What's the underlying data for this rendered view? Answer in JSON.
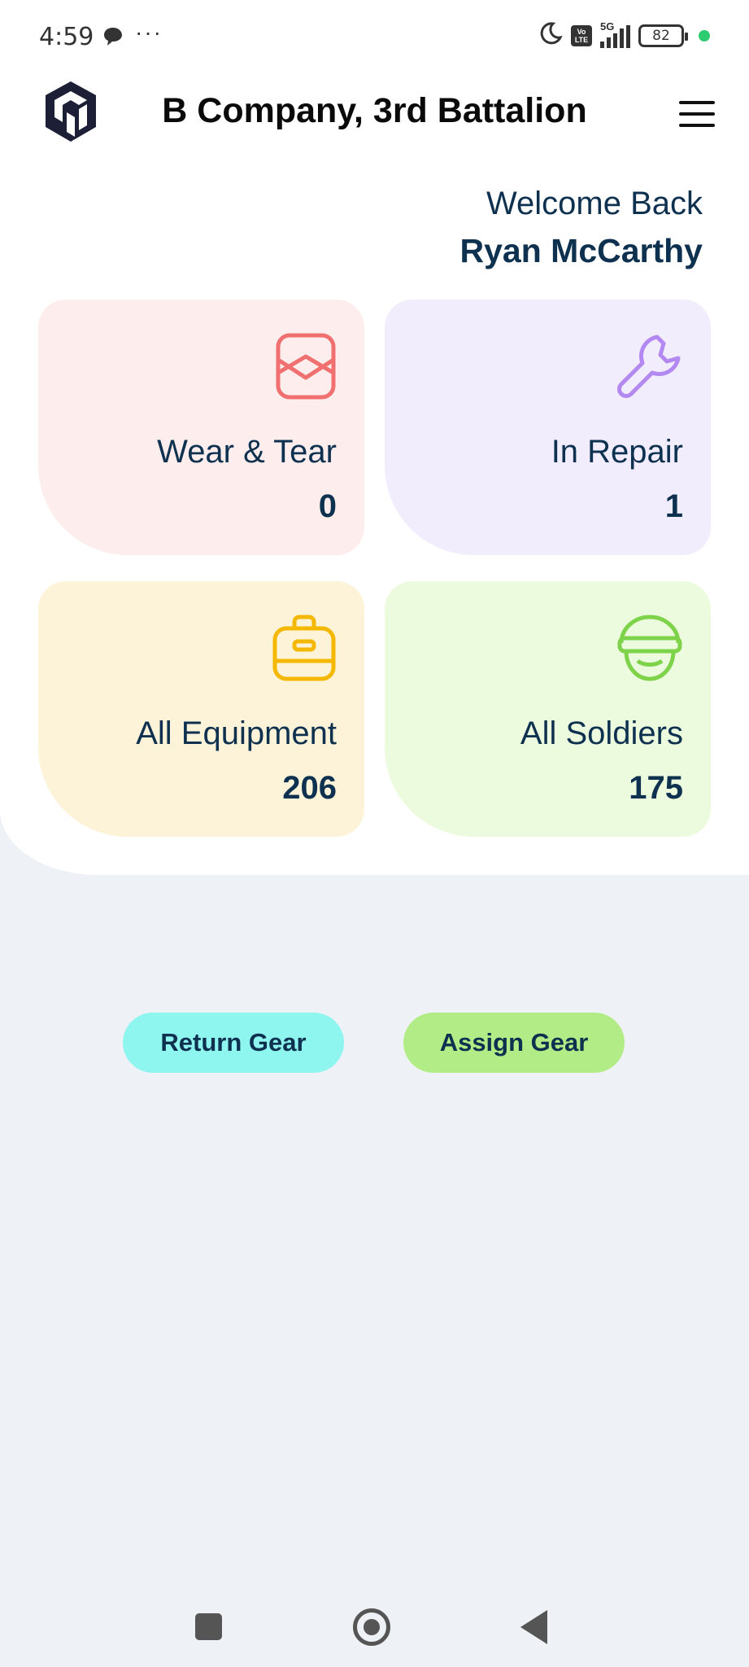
{
  "status_bar": {
    "time": "4:59",
    "dots": "···",
    "network": "5G",
    "volte": [
      "Vo",
      "LTE"
    ],
    "battery": "82"
  },
  "header": {
    "title": "B Company, 3rd Battalion"
  },
  "welcome": {
    "greeting": "Welcome Back",
    "user_name": "Ryan McCarthy"
  },
  "cards": {
    "wear_tear": {
      "label": "Wear & Tear",
      "count": "0",
      "color": "#f07070",
      "bg": "#fdeeed"
    },
    "in_repair": {
      "label": "In Repair",
      "count": "1",
      "color": "#b388f0",
      "bg": "#f1edfd"
    },
    "all_equipment": {
      "label": "All Equipment",
      "count": "206",
      "color": "#f5b800",
      "bg": "#fdf3d9"
    },
    "all_soldiers": {
      "label": "All Soldiers",
      "count": "175",
      "color": "#7ed34a",
      "bg": "#ecfbde"
    }
  },
  "actions": {
    "return_label": "Return Gear",
    "assign_label": "Assign Gear"
  },
  "icons": [
    "chat-icon",
    "moon-icon",
    "signal-icon",
    "battery-icon",
    "logo-icon",
    "menu-icon",
    "wear-tear-icon",
    "wrench-icon",
    "briefcase-icon",
    "helmet-icon",
    "recent-apps-icon",
    "home-icon",
    "back-icon"
  ]
}
